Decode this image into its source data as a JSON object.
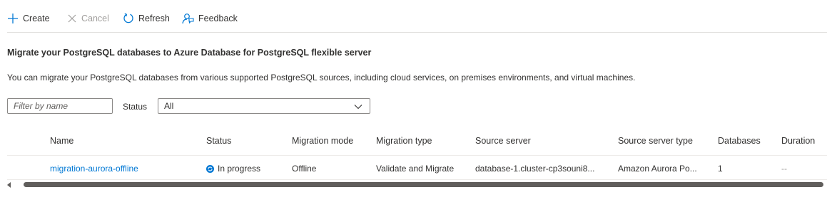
{
  "toolbar": {
    "create_label": "Create",
    "cancel_label": "Cancel",
    "refresh_label": "Refresh",
    "feedback_label": "Feedback"
  },
  "heading": "Migrate your PostgreSQL databases to Azure Database for PostgreSQL flexible server",
  "description": "You can migrate your PostgreSQL databases from various supported PostgreSQL sources, including cloud services, on premises environments, and virtual machines.",
  "filters": {
    "name_placeholder": "Filter by name",
    "status_label": "Status",
    "status_value": "All"
  },
  "table": {
    "columns": [
      "Name",
      "Status",
      "Migration mode",
      "Migration type",
      "Source server",
      "Source server type",
      "Databases",
      "Duration"
    ],
    "rows": [
      {
        "name": "migration-aurora-offline",
        "status": "In progress",
        "migration_mode": "Offline",
        "migration_type": "Validate and Migrate",
        "source_server": "database-1.cluster-cp3souni8...",
        "source_server_type": "Amazon Aurora Po...",
        "databases": "1",
        "duration": "--"
      }
    ]
  },
  "colors": {
    "accent": "#0078d4",
    "text": "#323130",
    "disabled": "#a19f9d",
    "border": "#8a8886"
  },
  "icons": {
    "create": "plus-icon",
    "cancel": "close-icon",
    "refresh": "refresh-icon",
    "feedback": "feedback-icon",
    "status": "in-progress-icon",
    "dropdown": "chevron-down-icon"
  }
}
